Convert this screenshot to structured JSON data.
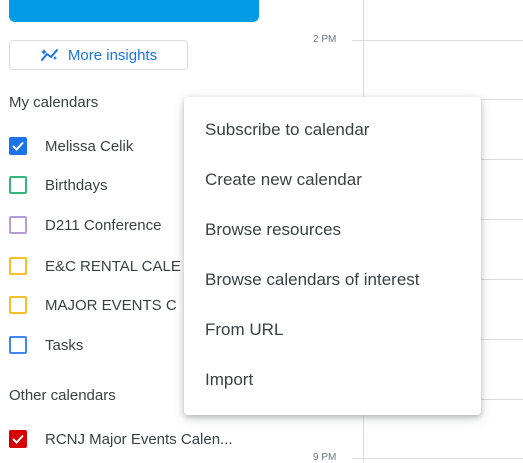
{
  "insights": {
    "label": "More insights"
  },
  "my_calendars": {
    "title": "My calendars",
    "items": [
      {
        "label": "Melissa Celik",
        "color": "#1a73e8",
        "checked": true
      },
      {
        "label": "Birthdays",
        "color": "#33b679",
        "checked": false
      },
      {
        "label": "D211 Conference",
        "color": "#b39ddb",
        "checked": false
      },
      {
        "label": "E&C RENTAL CALE",
        "color": "#f6bf26",
        "checked": false
      },
      {
        "label": "MAJOR EVENTS C",
        "color": "#f6bf26",
        "checked": false
      },
      {
        "label": "Tasks",
        "color": "#4285f4",
        "checked": false
      }
    ]
  },
  "other_calendars": {
    "title": "Other calendars",
    "items": [
      {
        "label": "RCNJ Major Events Calen...",
        "color": "#d50000",
        "checked": true
      }
    ]
  },
  "time_labels": {
    "t1": "2 PM",
    "t2": "9 PM"
  },
  "menu": {
    "items": [
      "Subscribe to calendar",
      "Create new calendar",
      "Browse resources",
      "Browse calendars of interest",
      "From URL",
      "Import"
    ]
  },
  "colors": {
    "accent": "#1a73e8",
    "top_bar": "#039be5"
  }
}
